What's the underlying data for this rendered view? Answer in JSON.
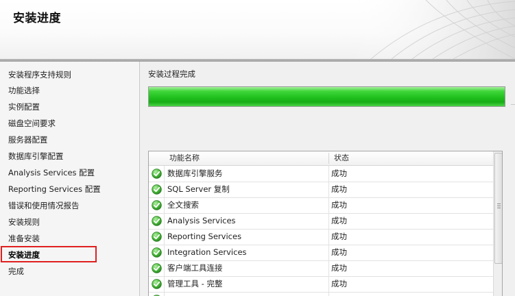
{
  "header": {
    "title": "安装进度"
  },
  "nav": {
    "items": [
      {
        "label": "安装程序支持规则"
      },
      {
        "label": "功能选择"
      },
      {
        "label": "实例配置"
      },
      {
        "label": "磁盘空间要求"
      },
      {
        "label": "服务器配置"
      },
      {
        "label": "数据库引擎配置"
      },
      {
        "label": "Analysis Services 配置"
      },
      {
        "label": "Reporting Services 配置"
      },
      {
        "label": "错误和使用情况报告"
      },
      {
        "label": "安装规则"
      },
      {
        "label": "准备安装"
      },
      {
        "label": "安装进度"
      },
      {
        "label": "完成"
      }
    ],
    "active_index": 11
  },
  "status_text": "安装过程完成",
  "progress": {
    "percent": 100,
    "color": "#20c01e"
  },
  "table": {
    "columns": [
      "功能名称",
      "状态"
    ],
    "rows": [
      {
        "name": "数据库引擎服务",
        "status": "成功",
        "icon": "success-check-icon"
      },
      {
        "name": "SQL Server 复制",
        "status": "成功",
        "icon": "success-check-icon"
      },
      {
        "name": "全文搜索",
        "status": "成功",
        "icon": "success-check-icon"
      },
      {
        "name": "Analysis Services",
        "status": "成功",
        "icon": "success-check-icon"
      },
      {
        "name": "Reporting Services",
        "status": "成功",
        "icon": "success-check-icon"
      },
      {
        "name": "Integration Services",
        "status": "成功",
        "icon": "success-check-icon"
      },
      {
        "name": "客户端工具连接",
        "status": "成功",
        "icon": "success-check-icon"
      },
      {
        "name": "管理工具 - 完整",
        "status": "成功",
        "icon": "success-check-icon"
      },
      {
        "name": "",
        "status": "",
        "icon": "success-check-icon"
      }
    ]
  },
  "colors": {
    "accent_highlight": "#e01e1e",
    "success_icon": "#2f9e26"
  }
}
